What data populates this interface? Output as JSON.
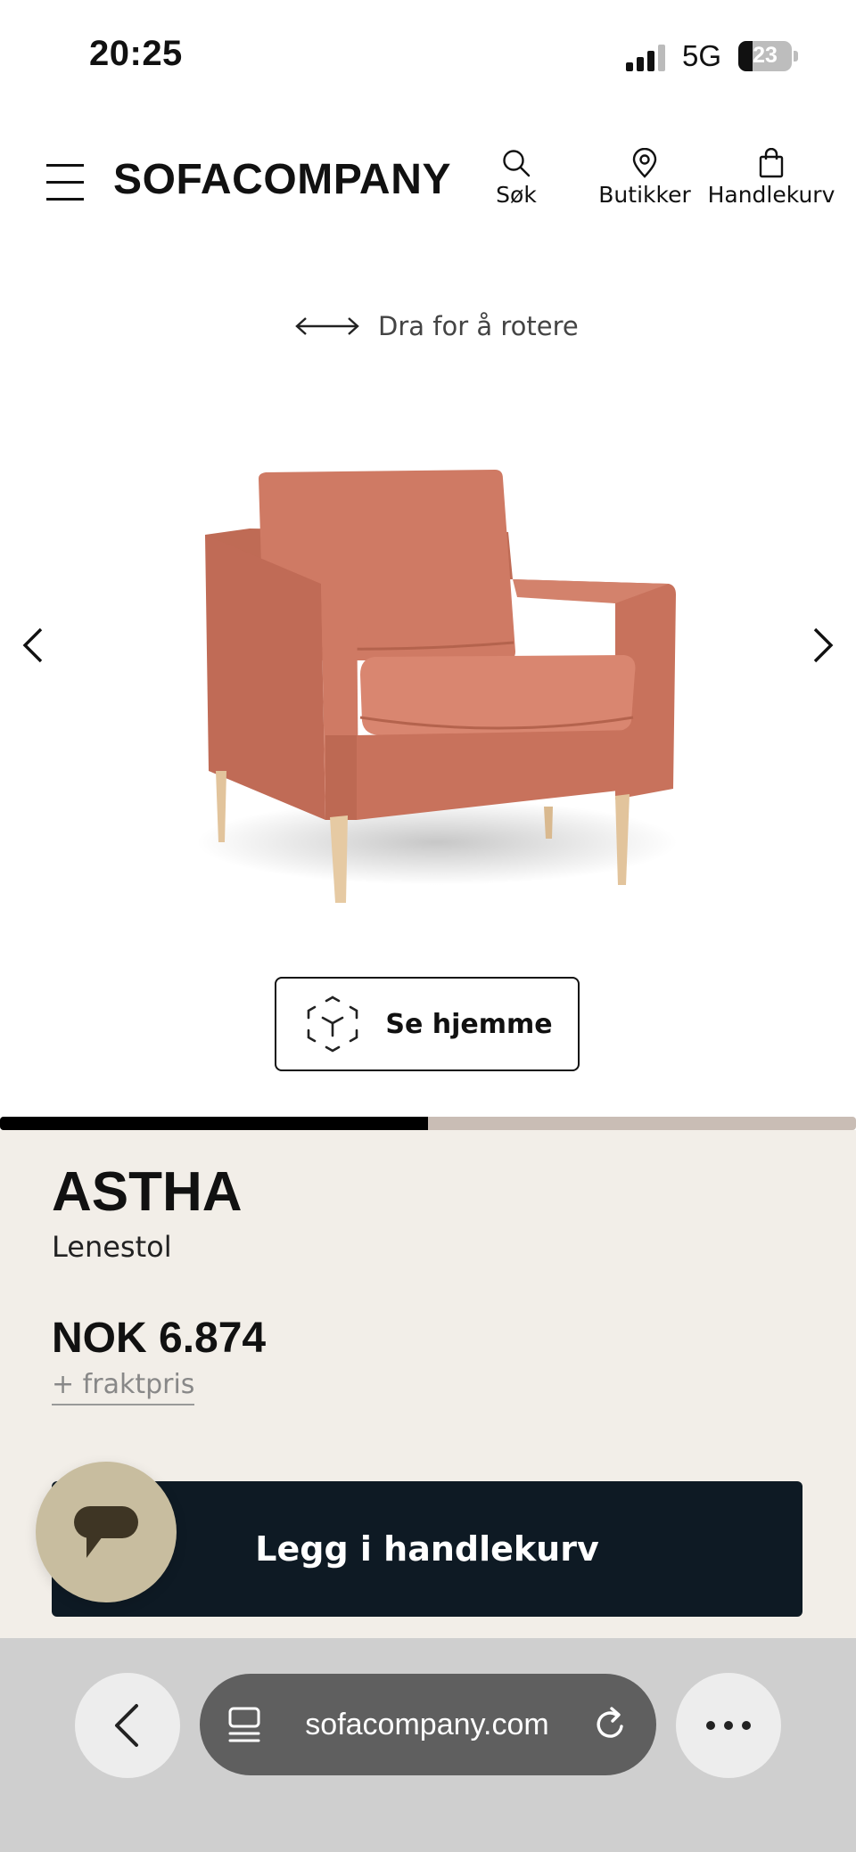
{
  "status_bar": {
    "time": "20:25",
    "network": "5G",
    "battery": "23"
  },
  "header": {
    "brand": "SOFACOMPANY",
    "menu_icon": "hamburger-icon",
    "nav": [
      {
        "label": "Søk",
        "icon": "search-icon"
      },
      {
        "label": "Butikker",
        "icon": "location-pin-icon"
      },
      {
        "label": "Handlekurv",
        "icon": "shopping-bag-icon"
      }
    ]
  },
  "product_view": {
    "rotate_hint": "Dra for å rotere",
    "ar_button_label": "Se hjemme",
    "gallery_progress": 0.5
  },
  "product": {
    "name": "ASTHA",
    "type": "Lenestol",
    "price": "NOK 6.874",
    "shipping_link": "+ fraktpris",
    "add_to_cart_label": "Legg i handlekurv",
    "color": "#cf7a64"
  },
  "browser": {
    "url": "sofacompany.com"
  },
  "colors": {
    "panel_bg": "#f2eee8",
    "cta_bg": "#0e1a24",
    "chat_bg": "#c8bd9f"
  }
}
